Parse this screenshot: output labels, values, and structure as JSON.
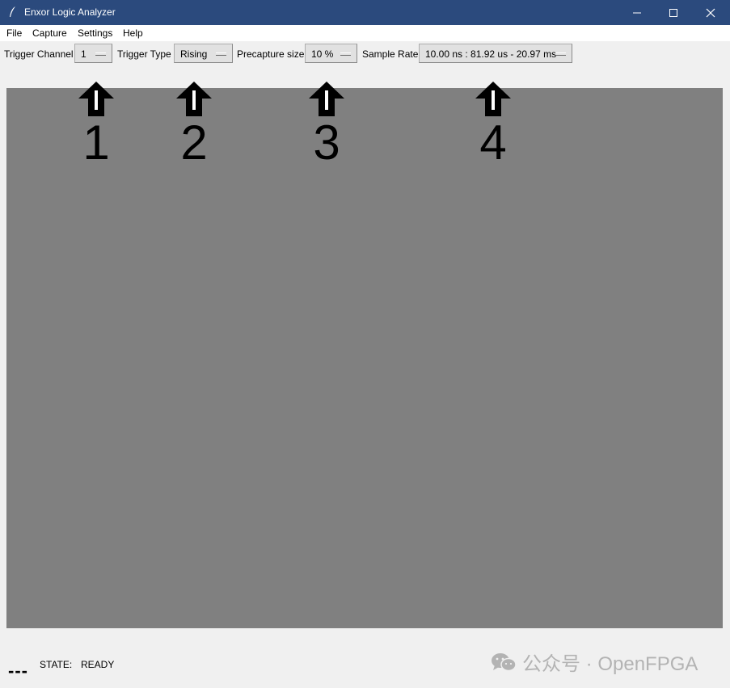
{
  "window": {
    "title": "Enxor Logic Analyzer",
    "title_bar_color": "#2b4a7d"
  },
  "menu": {
    "items": [
      "File",
      "Capture",
      "Settings",
      "Help"
    ]
  },
  "toolbar": {
    "trigger_channel": {
      "label": "Trigger Channel",
      "value": "1"
    },
    "trigger_type": {
      "label": "Trigger Type",
      "value": "Rising"
    },
    "precapture_size": {
      "label": "Precapture size",
      "value": "10 %"
    },
    "sample_rate": {
      "label": "Sample Rate",
      "value": "10.00 ns : 81.92 us - 20.97 ms"
    }
  },
  "canvas": {
    "background": "#808080"
  },
  "callouts": [
    "1",
    "2",
    "3",
    "4"
  ],
  "status": {
    "indicator": "---",
    "state_label": "STATE:",
    "state_value": "READY"
  },
  "watermark": {
    "text": "公众号 · OpenFPGA",
    "icon": "wechat-icon"
  }
}
